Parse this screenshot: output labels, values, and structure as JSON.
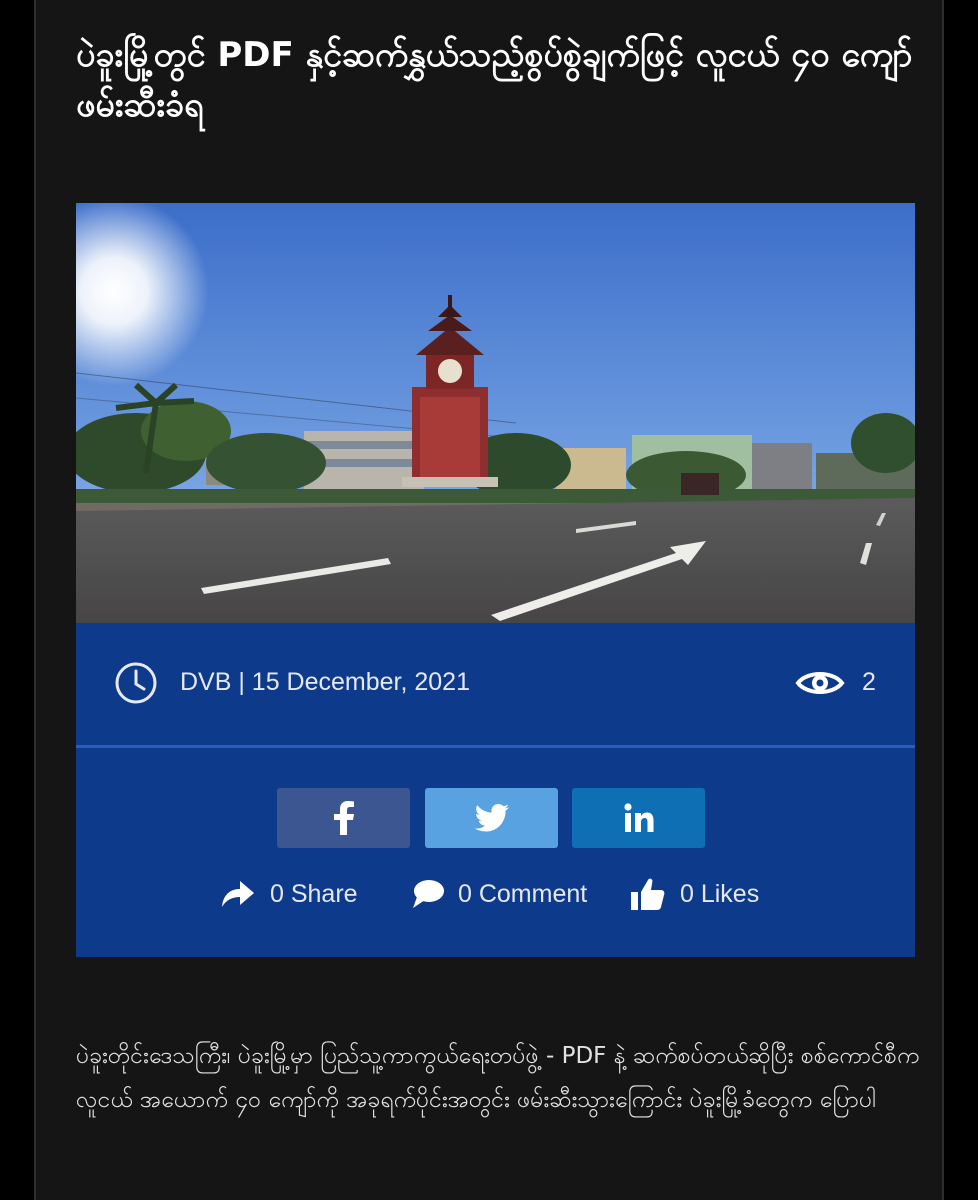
{
  "article": {
    "title": "ပဲခူးမြို့တွင် PDF နှင့်ဆက်နွှယ်သည့်စွပ်စွဲချက်ဖြင့် လူငယ် ၄၀ ကျော် ဖမ်းဆီးခံရ",
    "image_alt": "Pegu clock tower on an empty street",
    "meta": {
      "author_date": "DVB | 15 December, 2021",
      "views": "2"
    },
    "share": {
      "share_label": "0 Share",
      "comment_label": "0 Comment",
      "likes_label": "0 Likes"
    },
    "body": "ပဲခူးတိုင်းဒေသကြီး၊ ပဲခူးမြို့မှာ ပြည်သူ့ကာကွယ်ရေးတပ်ဖွဲ့ - PDF နဲ့ ဆက်စပ်တယ်ဆိုပြီး  စစ်ကောင်စီက လူငယ် အယောက် ၄၀ ကျော်ကို အခုရက်ပိုင်းအတွင်း ဖမ်းဆီးသွားကြောင်း ပဲခူးမြို့ခံတွေက ပြောပါ"
  },
  "colors": {
    "page_bg": "#151515",
    "meta_bar": "#0d3a8a",
    "facebook": "#3b5690",
    "twitter": "#58a2e2",
    "linkedin": "#0f6fb5"
  },
  "icons": [
    "clock-icon",
    "eye-icon",
    "facebook-icon",
    "twitter-icon",
    "linkedin-icon",
    "share-arrow-icon",
    "comment-icon",
    "thumbs-up-icon"
  ]
}
